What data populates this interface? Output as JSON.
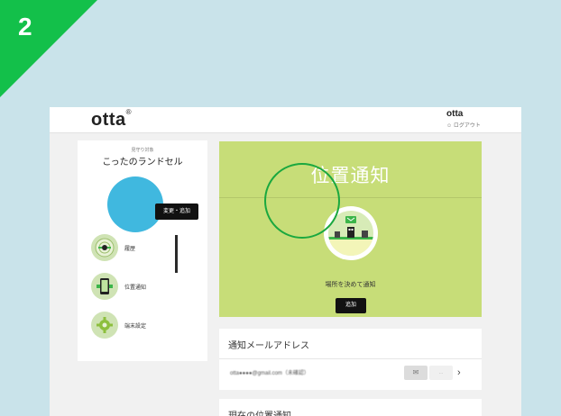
{
  "step": {
    "number": "2",
    "color": "#13c04a"
  },
  "header": {
    "logo": "otta",
    "logo_mark": "®",
    "user_name": "otta",
    "logout_label": "ログアウト"
  },
  "sidebar": {
    "profile_small": "見守り対象",
    "profile_name": "こったのランドセル",
    "avatar_color": "#40b8df",
    "edit_label": "変更・追加",
    "items": [
      {
        "label": "履歴",
        "icon": "radar-icon"
      },
      {
        "label": "位置通知",
        "icon": "phone-map-icon"
      },
      {
        "label": "端末設定",
        "icon": "gear-icon"
      }
    ]
  },
  "main": {
    "title": "位置通知",
    "description": "場所を決めて通知",
    "button_label": "追加",
    "bg_color": "#c7dd78"
  },
  "email": {
    "title": "通知メールアドレス",
    "address": "otta●●●●@gmail.com（未確認）",
    "mid_label": "…",
    "chevron": "›"
  },
  "current": {
    "title": "現在の位置通知"
  }
}
